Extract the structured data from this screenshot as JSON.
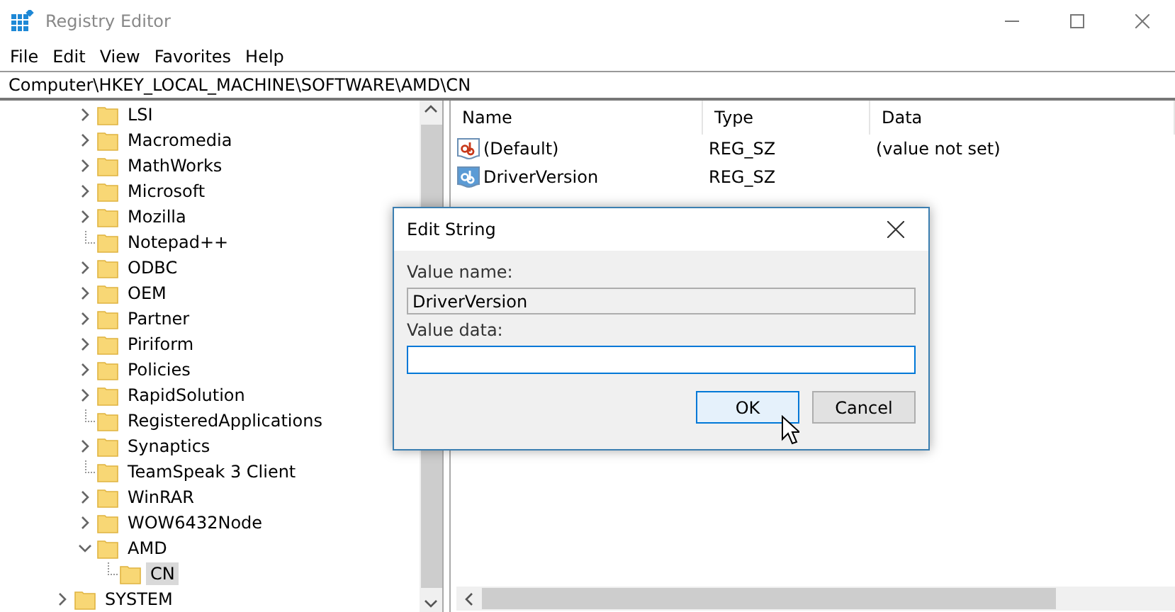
{
  "window": {
    "title": "Registry Editor"
  },
  "menu": [
    "File",
    "Edit",
    "View",
    "Favorites",
    "Help"
  ],
  "address": "Computer\\HKEY_LOCAL_MACHINE\\SOFTWARE\\AMD\\CN",
  "tree": {
    "items": [
      {
        "label": "LSI",
        "expandable": true,
        "expanded": false,
        "selected": false
      },
      {
        "label": "Macromedia",
        "expandable": true,
        "expanded": false,
        "selected": false
      },
      {
        "label": "MathWorks",
        "expandable": true,
        "expanded": false,
        "selected": false
      },
      {
        "label": "Microsoft",
        "expandable": true,
        "expanded": false,
        "selected": false
      },
      {
        "label": "Mozilla",
        "expandable": true,
        "expanded": false,
        "selected": false
      },
      {
        "label": "Notepad++",
        "expandable": false,
        "selected": false
      },
      {
        "label": "ODBC",
        "expandable": true,
        "expanded": false,
        "selected": false
      },
      {
        "label": "OEM",
        "expandable": true,
        "expanded": false,
        "selected": false
      },
      {
        "label": "Partner",
        "expandable": true,
        "expanded": false,
        "selected": false
      },
      {
        "label": "Piriform",
        "expandable": true,
        "expanded": false,
        "selected": false
      },
      {
        "label": "Policies",
        "expandable": true,
        "expanded": false,
        "selected": false
      },
      {
        "label": "RapidSolution",
        "expandable": true,
        "expanded": false,
        "selected": false
      },
      {
        "label": "RegisteredApplications",
        "expandable": false,
        "selected": false
      },
      {
        "label": "Synaptics",
        "expandable": true,
        "expanded": false,
        "selected": false
      },
      {
        "label": "TeamSpeak 3 Client",
        "expandable": false,
        "selected": false
      },
      {
        "label": "WinRAR",
        "expandable": true,
        "expanded": false,
        "selected": false
      },
      {
        "label": "WOW6432Node",
        "expandable": true,
        "expanded": false,
        "selected": false
      },
      {
        "label": "AMD",
        "expandable": true,
        "expanded": true,
        "selected": false,
        "children": [
          {
            "label": "CN",
            "expandable": false,
            "selected": true
          }
        ]
      }
    ],
    "parent_level_items": [
      {
        "label": "SYSTEM",
        "expandable": true,
        "expanded": false,
        "selected": false
      }
    ]
  },
  "values": {
    "columns": [
      "Name",
      "Type",
      "Data"
    ],
    "rows": [
      {
        "kind": "default",
        "name": "(Default)",
        "type": "REG_SZ",
        "data": "(value not set)"
      },
      {
        "kind": "string",
        "name": "DriverVersion",
        "type": "REG_SZ"
      }
    ]
  },
  "dialog": {
    "title": "Edit String",
    "name_label": "Value name:",
    "name_value": "DriverVersion",
    "data_label": "Value data:",
    "buttons": [
      {
        "label": "OK",
        "focused": true
      },
      {
        "label": "Cancel",
        "focused": false
      }
    ]
  }
}
